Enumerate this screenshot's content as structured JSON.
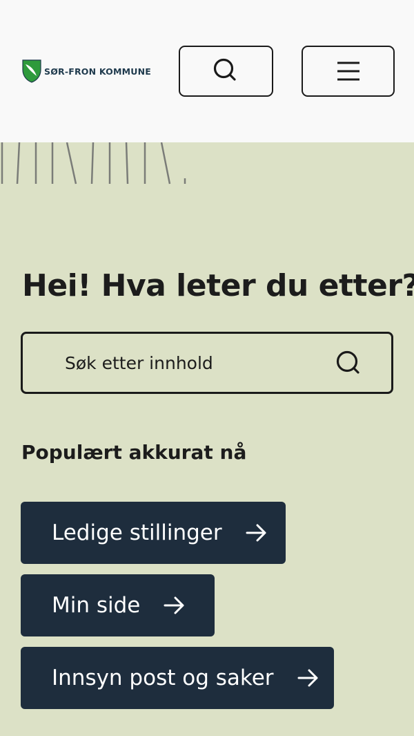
{
  "header": {
    "logo_text": "SØR-FRON KOMMUNE",
    "search_button_icon": "search-icon",
    "menu_button_icon": "hamburger-icon"
  },
  "main": {
    "heading": "Hei! Hva leter du etter?",
    "search": {
      "placeholder": "Søk etter innhold",
      "value": ""
    },
    "popular_title": "Populært akkurat nå",
    "popular_links": [
      {
        "label": "Ledige stillinger",
        "icon": "arrow-right-icon"
      },
      {
        "label": "Min side",
        "icon": "arrow-right-icon"
      },
      {
        "label": "Innsyn post og saker",
        "icon": "arrow-right-icon"
      }
    ]
  },
  "colors": {
    "background": "#dce1c6",
    "header_background": "#f9f9f9",
    "button_dark": "#1e2d3d",
    "logo_green": "#2e9a3c"
  }
}
